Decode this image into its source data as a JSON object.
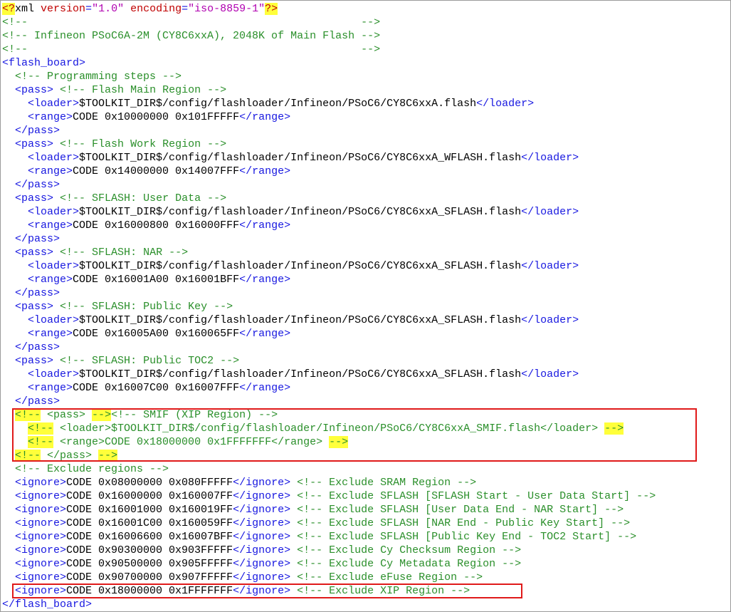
{
  "lines": [
    {
      "segs": [
        [
          "<?",
          "a hl"
        ],
        [
          "xml ",
          "t"
        ],
        [
          "version",
          "a"
        ],
        [
          "=",
          "b"
        ],
        [
          "\"1.0\"",
          "p"
        ],
        [
          " ",
          "t"
        ],
        [
          "encoding",
          "a"
        ],
        [
          "=",
          "b"
        ],
        [
          "\"iso-8859-1\"",
          "p"
        ],
        [
          "?>",
          "a hl"
        ]
      ]
    },
    {
      "segs": [
        [
          "<!--                                                    -->",
          "c"
        ]
      ]
    },
    {
      "segs": [
        [
          "<!-- Infineon PSoC6A-2M (CY8C6xxA), 2048K of Main Flash -->",
          "c"
        ]
      ]
    },
    {
      "segs": [
        [
          "<!--                                                    -->",
          "c"
        ]
      ]
    },
    {
      "segs": [
        [
          "<flash_board>",
          "b"
        ]
      ]
    },
    {
      "segs": [
        [
          "  ",
          "t"
        ],
        [
          "<!-- Programming steps -->",
          "c"
        ]
      ]
    },
    {
      "segs": [
        [
          "  ",
          "t"
        ],
        [
          "<pass>",
          "b"
        ],
        [
          " ",
          "t"
        ],
        [
          "<!-- Flash Main Region -->",
          "c"
        ]
      ]
    },
    {
      "segs": [
        [
          "    ",
          "t"
        ],
        [
          "<loader>",
          "b"
        ],
        [
          "$TOOLKIT_DIR$/config/flashloader/Infineon/PSoC6/CY8C6xxA.flash",
          "t"
        ],
        [
          "</loader>",
          "b"
        ]
      ]
    },
    {
      "segs": [
        [
          "    ",
          "t"
        ],
        [
          "<range>",
          "b"
        ],
        [
          "CODE 0x10000000 0x101FFFFF",
          "t"
        ],
        [
          "</range>",
          "b"
        ]
      ]
    },
    {
      "segs": [
        [
          "  ",
          "t"
        ],
        [
          "</pass>",
          "b"
        ]
      ]
    },
    {
      "segs": [
        [
          "  ",
          "t"
        ],
        [
          "<pass>",
          "b"
        ],
        [
          " ",
          "t"
        ],
        [
          "<!-- Flash Work Region -->",
          "c"
        ]
      ]
    },
    {
      "segs": [
        [
          "    ",
          "t"
        ],
        [
          "<loader>",
          "b"
        ],
        [
          "$TOOLKIT_DIR$/config/flashloader/Infineon/PSoC6/CY8C6xxA_WFLASH.flash",
          "t"
        ],
        [
          "</loader>",
          "b"
        ]
      ]
    },
    {
      "segs": [
        [
          "    ",
          "t"
        ],
        [
          "<range>",
          "b"
        ],
        [
          "CODE 0x14000000 0x14007FFF",
          "t"
        ],
        [
          "</range>",
          "b"
        ]
      ]
    },
    {
      "segs": [
        [
          "  ",
          "t"
        ],
        [
          "</pass>",
          "b"
        ]
      ]
    },
    {
      "segs": [
        [
          "  ",
          "t"
        ],
        [
          "<pass>",
          "b"
        ],
        [
          " ",
          "t"
        ],
        [
          "<!-- SFLASH: User Data -->",
          "c"
        ]
      ]
    },
    {
      "segs": [
        [
          "    ",
          "t"
        ],
        [
          "<loader>",
          "b"
        ],
        [
          "$TOOLKIT_DIR$/config/flashloader/Infineon/PSoC6/CY8C6xxA_SFLASH.flash",
          "t"
        ],
        [
          "</loader>",
          "b"
        ]
      ]
    },
    {
      "segs": [
        [
          "    ",
          "t"
        ],
        [
          "<range>",
          "b"
        ],
        [
          "CODE 0x16000800 0x16000FFF",
          "t"
        ],
        [
          "</range>",
          "b"
        ]
      ]
    },
    {
      "segs": [
        [
          "  ",
          "t"
        ],
        [
          "</pass>",
          "b"
        ]
      ]
    },
    {
      "segs": [
        [
          "  ",
          "t"
        ],
        [
          "<pass>",
          "b"
        ],
        [
          " ",
          "t"
        ],
        [
          "<!-- SFLASH: NAR -->",
          "c"
        ]
      ]
    },
    {
      "segs": [
        [
          "    ",
          "t"
        ],
        [
          "<loader>",
          "b"
        ],
        [
          "$TOOLKIT_DIR$/config/flashloader/Infineon/PSoC6/CY8C6xxA_SFLASH.flash",
          "t"
        ],
        [
          "</loader>",
          "b"
        ]
      ]
    },
    {
      "segs": [
        [
          "    ",
          "t"
        ],
        [
          "<range>",
          "b"
        ],
        [
          "CODE 0x16001A00 0x16001BFF",
          "t"
        ],
        [
          "</range>",
          "b"
        ]
      ]
    },
    {
      "segs": [
        [
          "  ",
          "t"
        ],
        [
          "</pass>",
          "b"
        ]
      ]
    },
    {
      "segs": [
        [
          "  ",
          "t"
        ],
        [
          "<pass>",
          "b"
        ],
        [
          " ",
          "t"
        ],
        [
          "<!-- SFLASH: Public Key -->",
          "c"
        ]
      ]
    },
    {
      "segs": [
        [
          "    ",
          "t"
        ],
        [
          "<loader>",
          "b"
        ],
        [
          "$TOOLKIT_DIR$/config/flashloader/Infineon/PSoC6/CY8C6xxA_SFLASH.flash",
          "t"
        ],
        [
          "</loader>",
          "b"
        ]
      ]
    },
    {
      "segs": [
        [
          "    ",
          "t"
        ],
        [
          "<range>",
          "b"
        ],
        [
          "CODE 0x16005A00 0x160065FF",
          "t"
        ],
        [
          "</range>",
          "b"
        ]
      ]
    },
    {
      "segs": [
        [
          "  ",
          "t"
        ],
        [
          "</pass>",
          "b"
        ]
      ]
    },
    {
      "segs": [
        [
          "  ",
          "t"
        ],
        [
          "<pass>",
          "b"
        ],
        [
          " ",
          "t"
        ],
        [
          "<!-- SFLASH: Public TOC2 -->",
          "c"
        ]
      ]
    },
    {
      "segs": [
        [
          "    ",
          "t"
        ],
        [
          "<loader>",
          "b"
        ],
        [
          "$TOOLKIT_DIR$/config/flashloader/Infineon/PSoC6/CY8C6xxA_SFLASH.flash",
          "t"
        ],
        [
          "</loader>",
          "b"
        ]
      ]
    },
    {
      "segs": [
        [
          "    ",
          "t"
        ],
        [
          "<range>",
          "b"
        ],
        [
          "CODE 0x16007C00 0x16007FFF",
          "t"
        ],
        [
          "</range>",
          "b"
        ]
      ]
    },
    {
      "segs": [
        [
          "  ",
          "t"
        ],
        [
          "</pass>",
          "b"
        ]
      ]
    },
    {
      "segs": [
        [
          "  ",
          "t"
        ],
        [
          "<!--",
          "c hl"
        ],
        [
          " <pass> ",
          "c"
        ],
        [
          "-->",
          "c hl"
        ],
        [
          "<!-- SMIF (XIP Region) -->",
          "c"
        ]
      ]
    },
    {
      "segs": [
        [
          "    ",
          "t"
        ],
        [
          "<!--",
          "c hl"
        ],
        [
          " <loader>$TOOLKIT_DIR$/config/flashloader/Infineon/PSoC6/CY8C6xxA_SMIF.flash</loader> ",
          "c"
        ],
        [
          "-->",
          "c hl"
        ]
      ]
    },
    {
      "segs": [
        [
          "    ",
          "t"
        ],
        [
          "<!--",
          "c hl"
        ],
        [
          " <range>CODE 0x18000000 0x1FFFFFFF</range> ",
          "c"
        ],
        [
          "-->",
          "c hl"
        ]
      ]
    },
    {
      "segs": [
        [
          "  ",
          "t"
        ],
        [
          "<!--",
          "c hl"
        ],
        [
          " </pass> ",
          "c"
        ],
        [
          "-->",
          "c hl"
        ]
      ]
    },
    {
      "segs": [
        [
          "  ",
          "t"
        ],
        [
          "<!-- Exclude regions -->",
          "c"
        ]
      ]
    },
    {
      "segs": [
        [
          "  ",
          "t"
        ],
        [
          "<ignore>",
          "b"
        ],
        [
          "CODE 0x08000000 0x080FFFFF",
          "t"
        ],
        [
          "</ignore>",
          "b"
        ],
        [
          " ",
          "t"
        ],
        [
          "<!-- Exclude SRAM Region -->",
          "c"
        ]
      ]
    },
    {
      "segs": [
        [
          "  ",
          "t"
        ],
        [
          "<ignore>",
          "b"
        ],
        [
          "CODE 0x16000000 0x160007FF",
          "t"
        ],
        [
          "</ignore>",
          "b"
        ],
        [
          " ",
          "t"
        ],
        [
          "<!-- Exclude SFLASH [SFLASH Start - User Data Start] -->",
          "c"
        ]
      ]
    },
    {
      "segs": [
        [
          "  ",
          "t"
        ],
        [
          "<ignore>",
          "b"
        ],
        [
          "CODE 0x16001000 0x160019FF",
          "t"
        ],
        [
          "</ignore>",
          "b"
        ],
        [
          " ",
          "t"
        ],
        [
          "<!-- Exclude SFLASH [User Data End - NAR Start] -->",
          "c"
        ]
      ]
    },
    {
      "segs": [
        [
          "  ",
          "t"
        ],
        [
          "<ignore>",
          "b"
        ],
        [
          "CODE 0x16001C00 0x160059FF",
          "t"
        ],
        [
          "</ignore>",
          "b"
        ],
        [
          " ",
          "t"
        ],
        [
          "<!-- Exclude SFLASH [NAR End - Public Key Start] -->",
          "c"
        ]
      ]
    },
    {
      "segs": [
        [
          "  ",
          "t"
        ],
        [
          "<ignore>",
          "b"
        ],
        [
          "CODE 0x16006600 0x16007BFF",
          "t"
        ],
        [
          "</ignore>",
          "b"
        ],
        [
          " ",
          "t"
        ],
        [
          "<!-- Exclude SFLASH [Public Key End - TOC2 Start] -->",
          "c"
        ]
      ]
    },
    {
      "segs": [
        [
          "  ",
          "t"
        ],
        [
          "<ignore>",
          "b"
        ],
        [
          "CODE 0x90300000 0x903FFFFF",
          "t"
        ],
        [
          "</ignore>",
          "b"
        ],
        [
          " ",
          "t"
        ],
        [
          "<!-- Exclude Cy Checksum Region -->",
          "c"
        ]
      ]
    },
    {
      "segs": [
        [
          "  ",
          "t"
        ],
        [
          "<ignore>",
          "b"
        ],
        [
          "CODE 0x90500000 0x905FFFFF",
          "t"
        ],
        [
          "</ignore>",
          "b"
        ],
        [
          " ",
          "t"
        ],
        [
          "<!-- Exclude Cy Metadata Region -->",
          "c"
        ]
      ]
    },
    {
      "segs": [
        [
          "  ",
          "t"
        ],
        [
          "<ignore>",
          "b"
        ],
        [
          "CODE 0x90700000 0x907FFFFF",
          "t"
        ],
        [
          "</ignore>",
          "b"
        ],
        [
          " ",
          "t"
        ],
        [
          "<!-- Exclude eFuse Region -->",
          "c"
        ]
      ]
    },
    {
      "segs": [
        [
          "  ",
          "t"
        ],
        [
          "<ignore>",
          "b"
        ],
        [
          "CODE 0x18000000 0x1FFFFFFF",
          "t"
        ],
        [
          "</ignore>",
          "b"
        ],
        [
          " ",
          "t"
        ],
        [
          "<!-- Exclude XIP Region -->",
          "c"
        ]
      ]
    },
    {
      "segs": [
        [
          "</flash_board>",
          "b"
        ]
      ]
    }
  ],
  "colors": {
    "tag": "#1717e0",
    "text": "#000000",
    "comment": "#2a8f2a",
    "attr_value": "#b000b0",
    "attr_name": "#c00000",
    "highlight": "#ffff3a",
    "annotation_box": "#e01a1a"
  }
}
